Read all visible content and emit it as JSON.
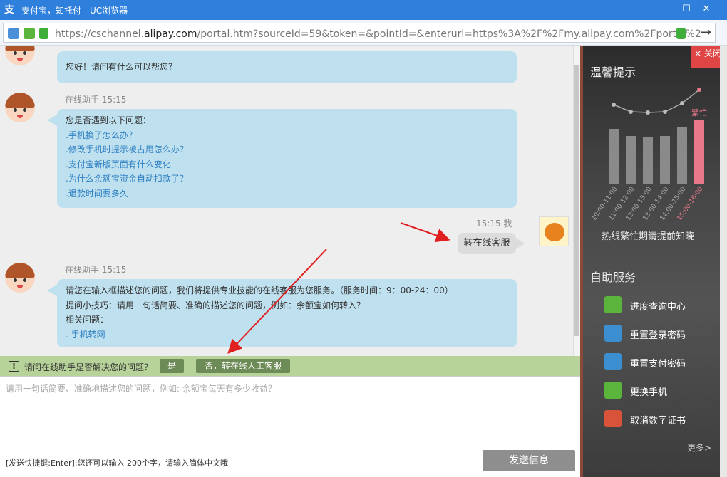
{
  "window": {
    "title": "支付宝，知托付 - UC浏览器",
    "url_prefix": "https://cschannel.",
    "url_domain": "alipay.com",
    "url_rest": "/portal.htm?sourceId=59&token=&pointId=&enterurl=https%3A%2F%2Fmy.alipay.com%2Fportal%2"
  },
  "chat": {
    "greeting": "您好！请问有什么可以帮您？",
    "messages": [
      {
        "meta": "在线助手 15:15",
        "intro": "您是否遇到以下问题：",
        "links": [
          ".手机换了怎么办？",
          ".修改手机时提示被占用怎么办？",
          ".支付宝新版页面有什么变化",
          ".为什么余额宝资金自动扣款了？",
          ".退款时间要多久"
        ]
      },
      {
        "meta": "在线助手 15:15",
        "lines": [
          "请您在输入框描述您的问题，我们将提供专业技能的在线客服为您服务。（服务时间：9：00-24：00）",
          "提问小技巧：请用一句话简要、准确的描述您的问题，例如：余额宝如何转入？",
          "相关问题："
        ],
        "link": ". 手机转网"
      }
    ],
    "my_meta": "15:15 我",
    "my_message": "转在线客服"
  },
  "feedback": {
    "question": "请问在线助手是否解决您的问题？",
    "yes": "是",
    "no": "否，转在线人工客服"
  },
  "input": {
    "placeholder": "请用一句话简要、准确地描述您的问题，例如: 余额宝每天有多少收益？",
    "hint": "[发送快捷键:Enter]:您还可以输入 200个字，请输入简体中文哦",
    "send": "发送信息"
  },
  "panel": {
    "close": "× 关闭",
    "tips_title": "温馨提示",
    "busy_label": "繁忙",
    "chart_note": "热线繁忙期请提前知晓",
    "self_service_title": "自助服务",
    "services": [
      {
        "label": "进度查询中心",
        "icon": "progress-query-icon",
        "color": "#5bb53d"
      },
      {
        "label": "重置登录密码",
        "icon": "reset-login-password-icon",
        "color": "#3b8fd0"
      },
      {
        "label": "重置支付密码",
        "icon": "reset-pay-password-icon",
        "color": "#3b8fd0"
      },
      {
        "label": "更换手机",
        "icon": "change-phone-icon",
        "color": "#5bb53d"
      },
      {
        "label": "取消数字证书",
        "icon": "cancel-certificate-icon",
        "color": "#d9533a"
      }
    ],
    "more": "更多>"
  },
  "chart_data": {
    "type": "bar",
    "categories": [
      "10:00-11:00",
      "11:00-12:00",
      "12:00-13:00",
      "13:00-14:00",
      "14:00-15:00",
      "15:00-16:00"
    ],
    "values": [
      78,
      68,
      67,
      68,
      80,
      91
    ],
    "highlight_index": 5,
    "highlight_label": "繁忙",
    "colors": {
      "bar": "#8a8a8a",
      "highlight": "#e8788a"
    }
  }
}
